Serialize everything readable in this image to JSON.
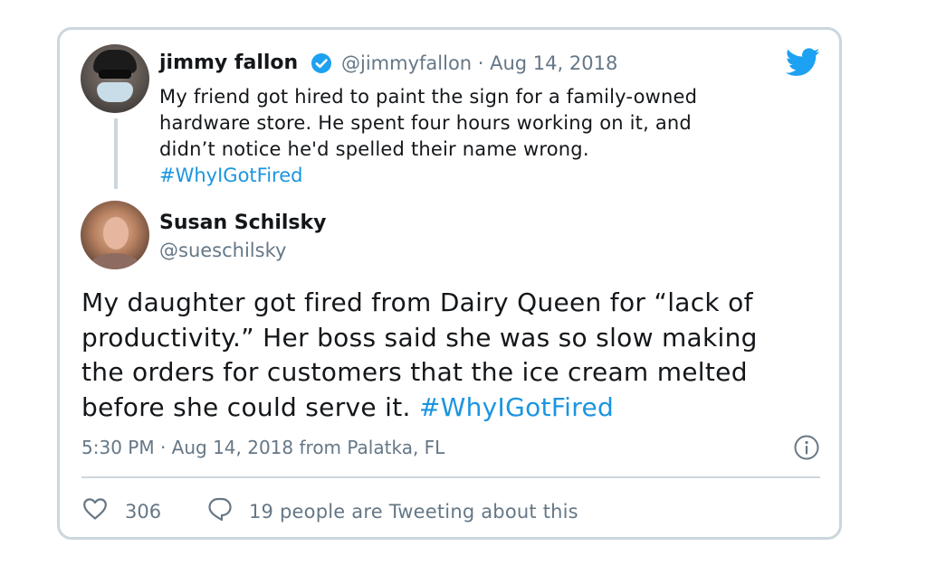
{
  "parent_tweet": {
    "author_name": "jimmy fallon",
    "handle_and_date": "@jimmyfallon · Aug 14, 2018",
    "lines": [
      "My friend got hired to paint the sign for a family-owned",
      "hardware store.  He spent four hours working on it, and",
      "didn’t notice he'd spelled their name wrong."
    ],
    "hashtag": "#WhyIGotFired"
  },
  "reply_tweet": {
    "author_name": "Susan Schilsky",
    "handle": "@sueschilsky",
    "lines": [
      "My daughter got fired from Dairy  Queen for “lack of",
      "productivity.” Her boss said she was so slow making",
      "the orders for customers that the ice cream melted",
      "before she could serve it."
    ],
    "hashtag": "#WhyIGotFired",
    "timestamp": "5:30 PM · Aug 14, 2018 from Palatka, FL"
  },
  "engagement": {
    "like_count": "306",
    "tweeting_text": "19 people are Tweeting about this"
  },
  "colors": {
    "accent": "#1b95e0",
    "secondary_text": "#657786",
    "border": "#ccd6dd",
    "verified": "#1da1f2"
  },
  "icons": [
    "verified-badge-icon",
    "twitter-bird-icon",
    "info-icon",
    "heart-icon",
    "speech-bubble-icon"
  ]
}
